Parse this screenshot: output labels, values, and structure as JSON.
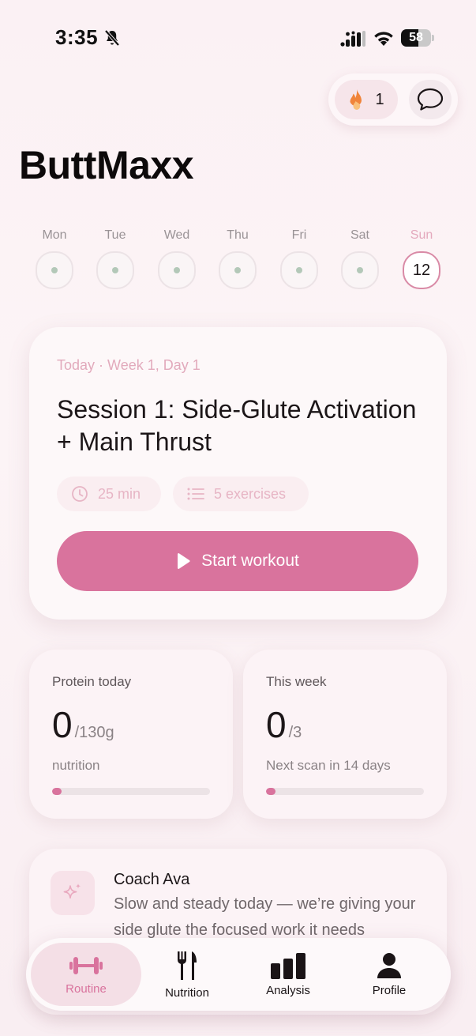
{
  "status_bar": {
    "time": "3:35",
    "battery": "58",
    "battery_level": 0.58,
    "icons": [
      "bell-slash-icon",
      "signal-icon",
      "wifi-icon",
      "battery-icon"
    ]
  },
  "header": {
    "streak_count": "1",
    "streak_icon": "flame-icon",
    "chat_icon": "chat-bubble-icon",
    "title": "ButtMaxx"
  },
  "week": [
    {
      "label": "Mon",
      "date": "",
      "today": false
    },
    {
      "label": "Tue",
      "date": "",
      "today": false
    },
    {
      "label": "Wed",
      "date": "",
      "today": false
    },
    {
      "label": "Thu",
      "date": "",
      "today": false
    },
    {
      "label": "Fri",
      "date": "",
      "today": false
    },
    {
      "label": "Sat",
      "date": "",
      "today": false
    },
    {
      "label": "Sun",
      "date": "12",
      "today": true
    }
  ],
  "workout": {
    "eyebrow": "Today · Week 1, Day 1",
    "title": "Session 1: Side-Glute Activation + Main Thrust",
    "duration": "25 min",
    "exercises": "5 exercises",
    "start_label": "Start workout"
  },
  "stats": {
    "protein": {
      "label": "Protein today",
      "value": "0",
      "unit": "/130g",
      "sub": "nutrition",
      "progress": 0
    },
    "week": {
      "label": "This week",
      "value": "0",
      "unit": "/3",
      "sub": "Next scan in 14 days",
      "progress": 0
    }
  },
  "coach": {
    "name": "Coach Ava",
    "message": "Slow and steady today — we’re giving your side glute the focused work it needs"
  },
  "tabs": [
    {
      "label": "Routine",
      "icon": "dumbbell-icon",
      "active": true
    },
    {
      "label": "Nutrition",
      "icon": "fork-knife-icon",
      "active": false
    },
    {
      "label": "Analysis",
      "icon": "bar-chart-icon",
      "active": false
    },
    {
      "label": "Profile",
      "icon": "person-icon",
      "active": false
    }
  ],
  "colors": {
    "accent": "#d9739d",
    "accent_light": "#e2aabc",
    "background": "#fbf1f4",
    "dot": "#b3c8b8"
  }
}
